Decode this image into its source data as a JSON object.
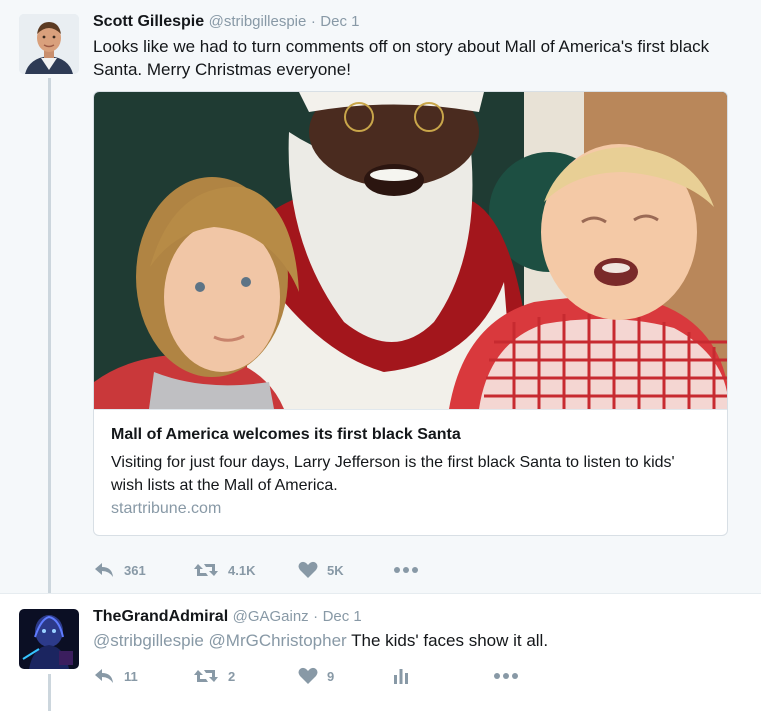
{
  "tweet1": {
    "author_name": "Scott Gillespie",
    "handle": "@stribgillespie",
    "separator": "·",
    "date": "Dec 1",
    "text": "Looks like we had to turn comments off on story about Mall of America's first black Santa. Merry Christmas everyone!",
    "card": {
      "title": "Mall of America welcomes its first black Santa",
      "description": "Visiting for just four days, Larry Jefferson is the first black Santa to listen to kids' wish lists at the Mall of America.",
      "domain": "startribune.com"
    },
    "actions": {
      "replies": "361",
      "retweets": "4.1K",
      "likes": "5K"
    }
  },
  "tweet2": {
    "author_name": "TheGrandAdmiral",
    "handle": "@GAGainz",
    "separator": "·",
    "date": "Dec 1",
    "mentions": "@stribgillespie @MrGChristopher",
    "text": "The kids' faces show it all.",
    "actions": {
      "replies": "11",
      "retweets": "2",
      "likes": "9"
    }
  },
  "icons": [
    "reply-icon",
    "retweet-icon",
    "like-icon",
    "more-icon",
    "analytics-icon"
  ],
  "colors": {
    "background": "#f5f8fa",
    "muted": "#8899a6",
    "text": "#14171a",
    "thread_line": "#ccd6dd"
  }
}
